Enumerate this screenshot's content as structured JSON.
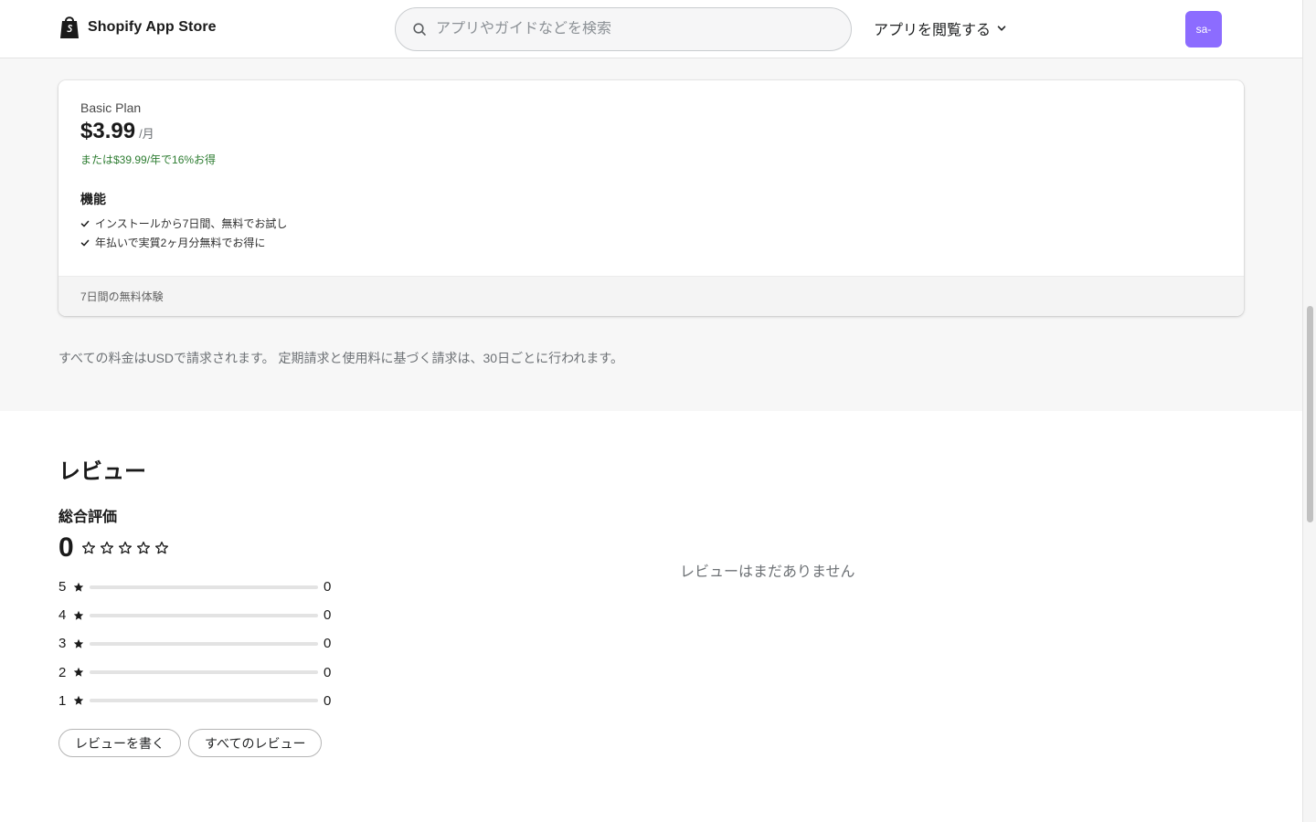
{
  "header": {
    "logo_text": "Shopify App Store",
    "search_placeholder": "アプリやガイドなどを検索",
    "search_value": "",
    "browse_label": "アプリを閲覧する",
    "avatar_text": "sa-"
  },
  "plan": {
    "name": "Basic Plan",
    "price": "$3.99",
    "unit": "/月",
    "annual_offer": "または$39.99/年で16%お得",
    "features_title": "機能",
    "features": [
      "インストールから7日間、無料でお試し",
      "年払いで実質2ヶ月分無料でお得に"
    ],
    "trial": "7日間の無料体験"
  },
  "billing_note": "すべての料金はUSDで請求されます。 定期請求と使用料に基づく請求は、30日ごとに行われます。",
  "reviews": {
    "title": "レビュー",
    "overall_label": "総合評価",
    "overall_score": "0",
    "overall_stars_filled": 0,
    "distribution": [
      {
        "stars": "5",
        "count": "0",
        "fraction": 0
      },
      {
        "stars": "4",
        "count": "0",
        "fraction": 0
      },
      {
        "stars": "3",
        "count": "0",
        "fraction": 0
      },
      {
        "stars": "2",
        "count": "0",
        "fraction": 0
      },
      {
        "stars": "1",
        "count": "0",
        "fraction": 0
      }
    ],
    "write_button": "レビューを書く",
    "all_button": "すべてのレビュー",
    "empty_text": "レビューはまだありません"
  },
  "colors": {
    "accent_green": "#2e7d32",
    "avatar": "#8c6cff"
  },
  "icons": [
    "shopify-bag-icon",
    "search-icon",
    "chevron-down-icon",
    "check-icon",
    "star-outline-icon",
    "star-filled-icon"
  ]
}
